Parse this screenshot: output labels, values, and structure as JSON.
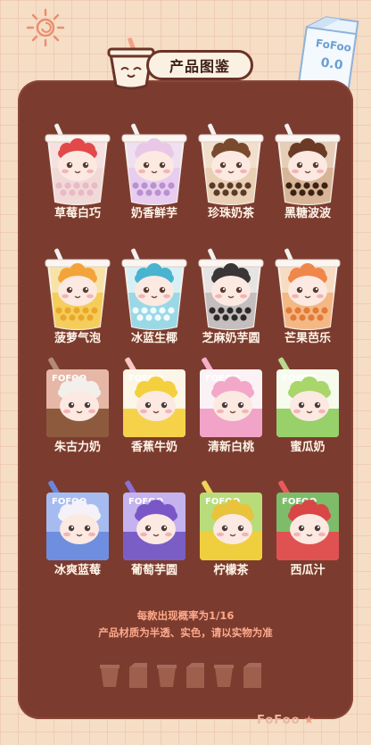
{
  "header": {
    "title": "产品图鉴",
    "milk_box_brand": "FoFoo",
    "milk_box_face": "0.0"
  },
  "rows": [
    {
      "kind": "cup",
      "items": [
        {
          "name": "草莓白巧",
          "hair": "#e24a4a",
          "cup": "#f6e0e0",
          "drink": "#f0d7d6",
          "pearl": "#e9b9c5"
        },
        {
          "name": "奶香鲜芋",
          "hair": "#e9c7e6",
          "cup": "#eee0f0",
          "drink": "#e6c9ef",
          "pearl": "#b991d1"
        },
        {
          "name": "珍珠奶茶",
          "hair": "#7a4a2e",
          "cup": "#f1dfcb",
          "drink": "#e8cdb0",
          "pearl": "#5a3a28"
        },
        {
          "name": "黑糖波波",
          "hair": "#6b3b25",
          "cup": "#e5cdb7",
          "drink": "#d5b090",
          "pearl": "#3b2216"
        }
      ]
    },
    {
      "kind": "cup",
      "items": [
        {
          "name": "菠萝气泡",
          "hair": "#f2a43a",
          "cup": "#f7e3a8",
          "drink": "#f5c94f",
          "pearl": "#eaa82a"
        },
        {
          "name": "冰蓝生椰",
          "hair": "#4ab3d0",
          "cup": "#d7f0f6",
          "drink": "#8fd3e3",
          "pearl": "#f0fbff"
        },
        {
          "name": "芝麻奶芋圆",
          "hair": "#3a3638",
          "cup": "#e6e3e3",
          "drink": "#bdb7b8",
          "pearl": "#2c2a2a"
        },
        {
          "name": "芒果芭乐",
          "hair": "#f0874a",
          "cup": "#f6dcc2",
          "drink": "#f2b179",
          "pearl": "#e37a39"
        }
      ]
    },
    {
      "kind": "box",
      "items": [
        {
          "name": "朱古力奶",
          "hair": "#f3f0ec",
          "box": "#8e5a3e",
          "top": "#e6b7a6",
          "brand": "FOFOO",
          "straw": "#b38a78"
        },
        {
          "name": "香蕉牛奶",
          "hair": "#f4d03f",
          "box": "#f5d24a",
          "top": "#fbf6e8",
          "brand": "FOFOO",
          "straw": "#f7c7c2"
        },
        {
          "name": "清新白桃",
          "hair": "#f3a8c8",
          "box": "#f2a3c8",
          "top": "#fbf2f6",
          "brand": "FOFOO",
          "straw": "#f5b0c7"
        },
        {
          "name": "蜜瓜奶",
          "hair": "#a8d66a",
          "box": "#98d06a",
          "top": "#f6fbee",
          "brand": "FOFOO",
          "straw": "#b8d98f"
        }
      ]
    },
    {
      "kind": "box",
      "items": [
        {
          "name": "冰爽蓝莓",
          "hair": "#f4f2f8",
          "box": "#6f8ee0",
          "top": "#a6bcf1",
          "brand": "FOFOO",
          "straw": "#6b86d8"
        },
        {
          "name": "葡萄芋圆",
          "hair": "#7a57c6",
          "box": "#7a5ec6",
          "top": "#c4b3ef",
          "brand": "FOFOO",
          "straw": "#8c6fd2"
        },
        {
          "name": "柠檬茶",
          "hair": "#e8c33b",
          "box": "#f0cf3e",
          "top": "#b9dc7a",
          "brand": "FOFOO",
          "straw": "#f0d25a"
        },
        {
          "name": "西瓜汁",
          "hair": "#d94646",
          "box": "#e05252",
          "top": "#7dbd6a",
          "brand": "FOFOO",
          "straw": "#ea5a5a"
        }
      ]
    }
  ],
  "notes": {
    "line1": "每款出现概率为1/16",
    "line2": "产品材质为半透、实色，请以实物为准"
  },
  "footer": {
    "brand": "FoFoo"
  }
}
